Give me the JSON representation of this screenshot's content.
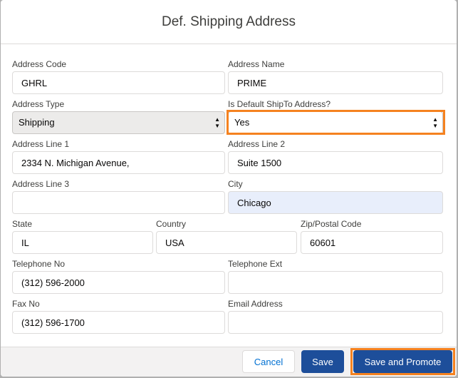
{
  "modal": {
    "title": "Def. Shipping Address"
  },
  "form": {
    "address_code": {
      "label": "Address Code",
      "value": "GHRL"
    },
    "address_name": {
      "label": "Address Name",
      "value": "PRIME"
    },
    "address_type": {
      "label": "Address Type",
      "value": "Shipping"
    },
    "is_default_shipto": {
      "label": "Is Default ShipTo Address?",
      "value": "Yes"
    },
    "address_line_1": {
      "label": "Address Line 1",
      "value": "2334 N. Michigan Avenue,"
    },
    "address_line_2": {
      "label": "Address Line 2",
      "value": "Suite 1500"
    },
    "address_line_3": {
      "label": "Address Line 3",
      "value": ""
    },
    "city": {
      "label": "City",
      "value": "Chicago"
    },
    "state": {
      "label": "State",
      "value": "IL"
    },
    "country": {
      "label": "Country",
      "value": "USA"
    },
    "zip": {
      "label": "Zip/Postal Code",
      "value": "60601"
    },
    "telephone_no": {
      "label": "Telephone No",
      "value": "(312) 596-2000"
    },
    "telephone_ext": {
      "label": "Telephone Ext",
      "value": ""
    },
    "fax_no": {
      "label": "Fax No",
      "value": "(312) 596-1700"
    },
    "email": {
      "label": "Email Address",
      "value": ""
    }
  },
  "footer": {
    "cancel_label": "Cancel",
    "save_label": "Save",
    "save_promote_label": "Save and Promote"
  },
  "colors": {
    "brand": "#1d4e9a",
    "highlight": "#f58220",
    "link": "#0070d2"
  },
  "icons": {
    "select_arrows": "updown-arrows-icon"
  }
}
